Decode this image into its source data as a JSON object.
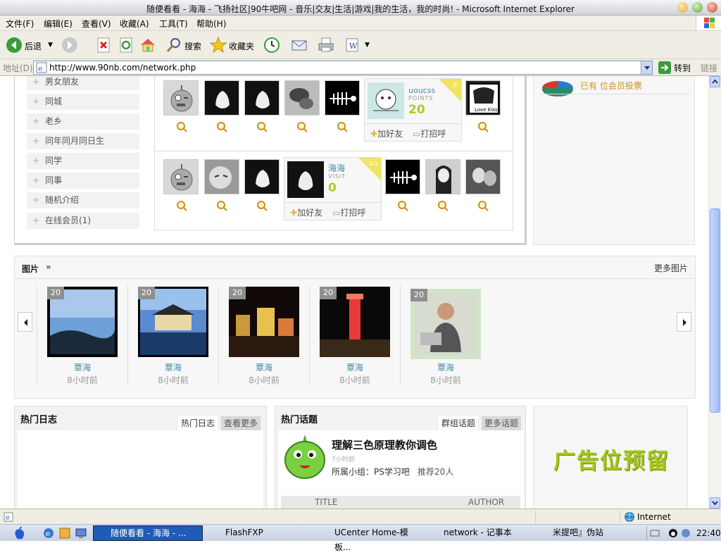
{
  "window": {
    "title": "随便看看 - 海海 - 飞扬社区|90牛吧网 - 音乐|交友|生活|游戏|我的生活，我的时尚! - Microsoft Internet Explorer"
  },
  "menu": [
    "文件(F)",
    "编辑(E)",
    "查看(V)",
    "收藏(A)",
    "工具(T)",
    "帮助(H)"
  ],
  "toolbar": {
    "back": "后退",
    "search": "搜索",
    "favorites": "收藏夹"
  },
  "address": {
    "label": "地址(D)",
    "url": "http://www.90nb.com/network.php",
    "go": "转到",
    "links": "链接"
  },
  "sidebar": {
    "items": [
      {
        "label": "男女朋友"
      },
      {
        "label": "同城"
      },
      {
        "label": "老乡"
      },
      {
        "label": "同年同月同日生"
      },
      {
        "label": "同学"
      },
      {
        "label": "同事"
      },
      {
        "label": "随机介绍"
      },
      {
        "label": "在线会员(1)"
      }
    ]
  },
  "cards": {
    "top": {
      "name": "uoucss",
      "kind": "POINTS",
      "value": "20",
      "tag": "JF",
      "add": "加好友",
      "greet": "打招呼"
    },
    "bottom": {
      "name": "海海",
      "kind": "VISIT",
      "value": "0",
      "tag": "RQ",
      "add": "加好友",
      "greet": "打招呼"
    }
  },
  "right_panel": {
    "text": "已有  位会员投票"
  },
  "pictures": {
    "title": "图片",
    "arrows": "»",
    "more": "更多图片",
    "items": [
      {
        "count": "20",
        "author": "覃海",
        "time": "8小时前"
      },
      {
        "count": "20",
        "author": "覃海",
        "time": "8小时前"
      },
      {
        "count": "20",
        "author": "覃海",
        "time": "8小时前"
      },
      {
        "count": "20",
        "author": "覃海",
        "time": "8小时前"
      },
      {
        "count": "20",
        "author": "覃海",
        "time": "8小时前"
      }
    ]
  },
  "hot_blog": {
    "title": "热门日志",
    "tab": "热门日志",
    "more": "查看更多"
  },
  "hot_topic": {
    "title": "热门话题",
    "tab": "群组话题",
    "more": "更多话题",
    "headline": "理解三色原理教你调色",
    "time": "7小时前",
    "group_label": "所属小组：",
    "group": "PS学习吧",
    "recommend": "推荐20人",
    "col_title": "TITLE",
    "col_author": "AUTHOR"
  },
  "ad": {
    "text": "广告位预留"
  },
  "status": {
    "zone": "Internet"
  },
  "taskbar": {
    "tasks": [
      "随便看看 - 海海 - ...",
      "FlashFXP",
      "UCenter Home-模板...",
      "network - 记事本",
      "米提吧』伪站"
    ],
    "clock": "22:40"
  },
  "colors": {
    "accent": "#3b6db3",
    "card_value": "#b8c52a",
    "ad_green": "#a6c81c",
    "right_text": "#d08f1a"
  }
}
